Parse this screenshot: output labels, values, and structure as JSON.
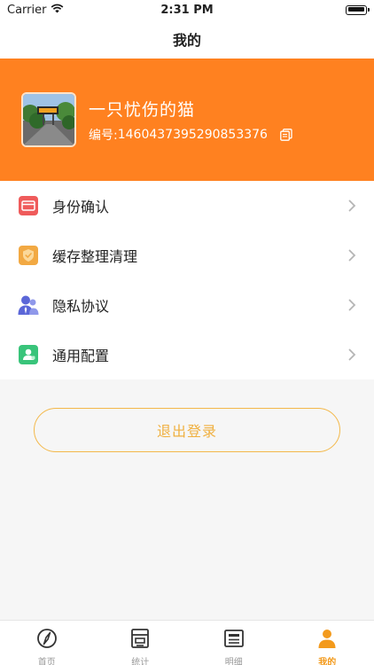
{
  "status_bar": {
    "carrier": "Carrier",
    "time": "2:31 PM"
  },
  "nav": {
    "title": "我的"
  },
  "profile": {
    "nickname": "一只忧伤的猫",
    "uid_label": "编号:",
    "uid": "1460437395290853376"
  },
  "menu": {
    "items": [
      {
        "label": "身份确认",
        "icon": "id-card-icon",
        "color": "#ef5b5b"
      },
      {
        "label": "缓存整理清理",
        "icon": "shield-check-icon",
        "color": "#f2a943"
      },
      {
        "label": "隐私协议",
        "icon": "users-icon",
        "color": "#5b67d8"
      },
      {
        "label": "通用配置",
        "icon": "config-icon",
        "color": "#39c47a"
      }
    ]
  },
  "logout": {
    "label": "退出登录"
  },
  "tabs": [
    {
      "label": "首页",
      "icon": "compass-icon",
      "active": false
    },
    {
      "label": "统计",
      "icon": "store-icon",
      "active": false
    },
    {
      "label": "明细",
      "icon": "list-icon",
      "active": false
    },
    {
      "label": "我的",
      "icon": "user-icon",
      "active": true
    }
  ],
  "colors": {
    "accent": "#ff8120",
    "tab_active": "#f39a1c",
    "logout_border": "#f3b84a"
  }
}
